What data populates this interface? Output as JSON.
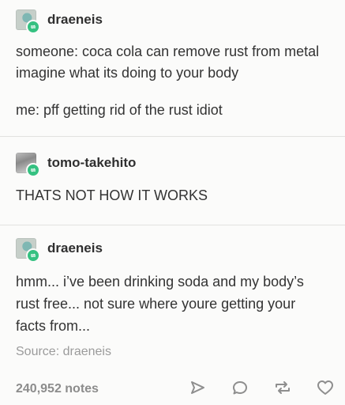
{
  "posts": [
    {
      "username": "draeneis",
      "paragraphs": [
        "someone: coca cola can remove rust from metal imagine what its doing to your body",
        "me: pff getting rid of the rust idiot"
      ]
    },
    {
      "username": "tomo-takehito",
      "paragraphs": [
        "THATS NOT HOW IT WORKS"
      ]
    },
    {
      "username": "draeneis",
      "paragraphs": [
        "hmm... i’ve been drinking soda and my body’s rust free... not sure where youre getting your facts from..."
      ]
    }
  ],
  "footer": {
    "source": "Source: draeneis",
    "notes": "240,952 notes"
  },
  "icons": {
    "share": "share-icon",
    "reply": "reply-icon",
    "reblog": "reblog-icon",
    "like": "heart-icon"
  },
  "colors": {
    "reblog_badge": "#35c181",
    "text": "#333333",
    "muted": "#9b9b9b"
  }
}
